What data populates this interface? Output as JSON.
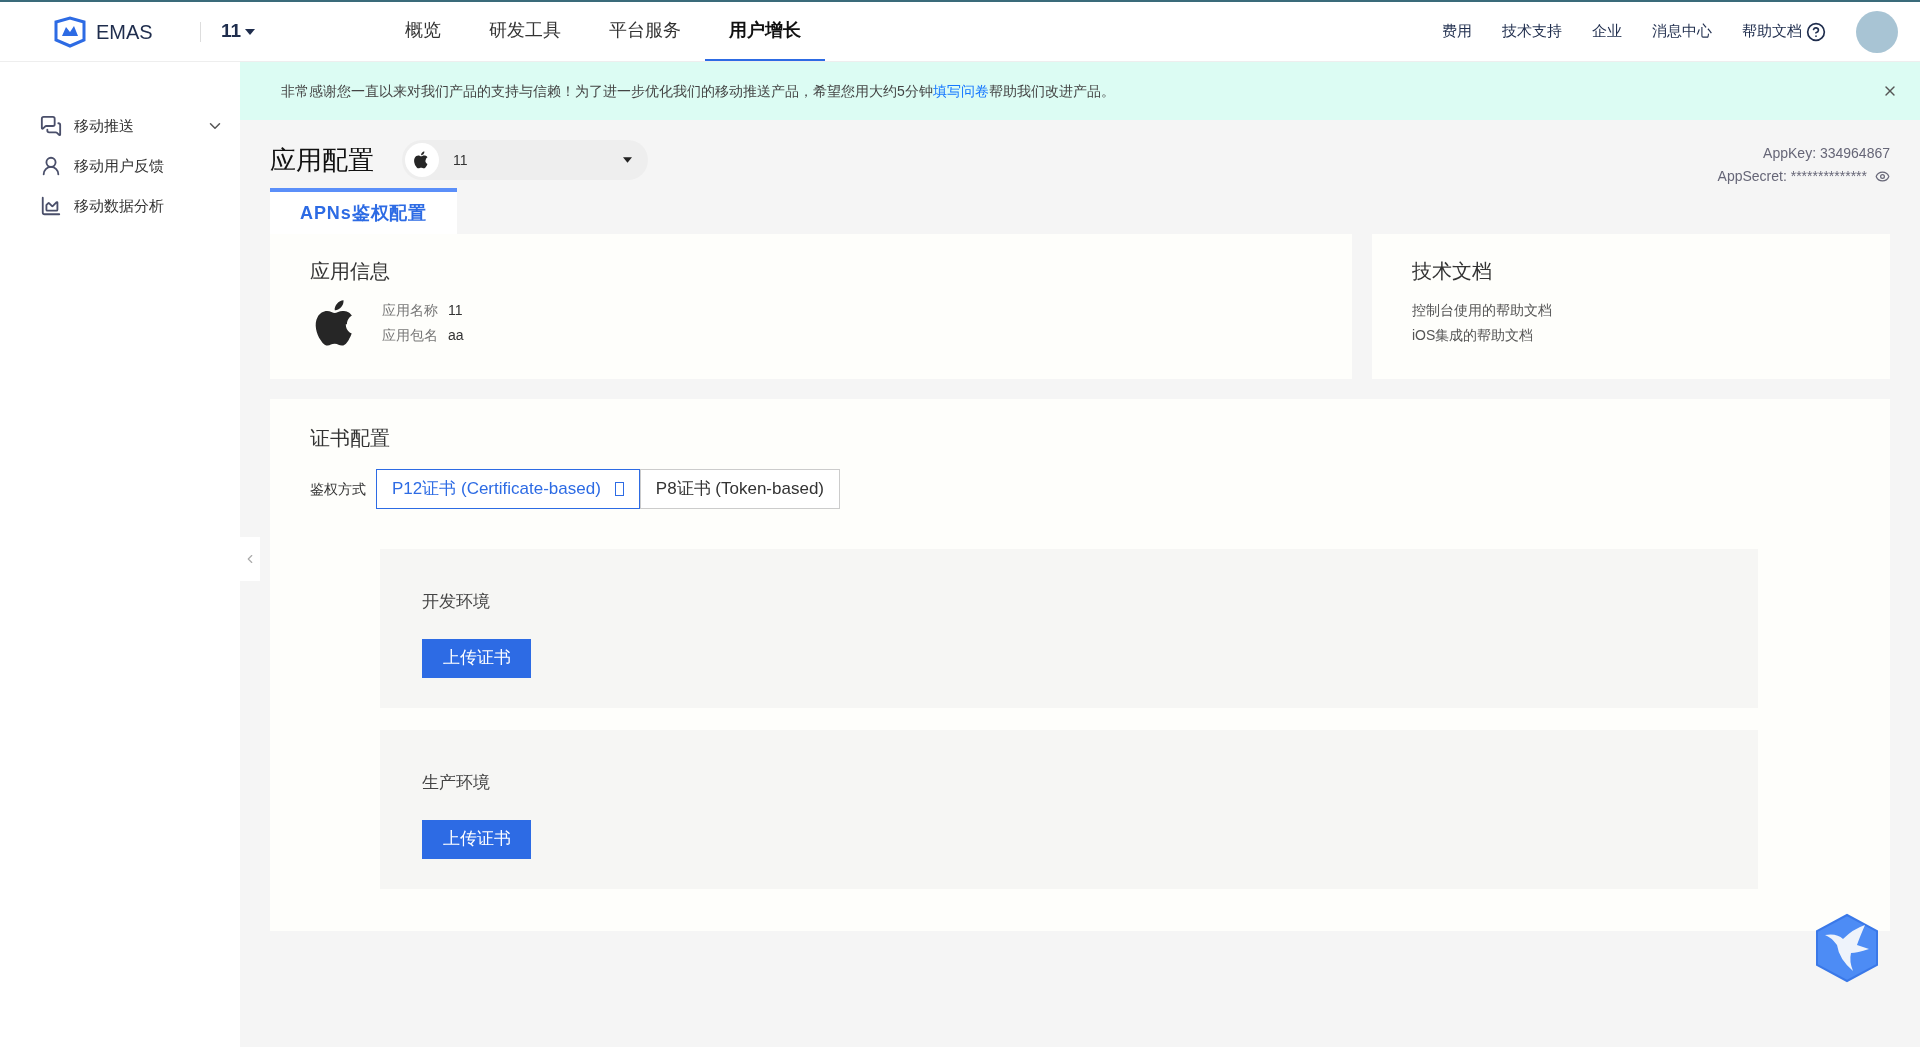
{
  "header": {
    "logo_text": "EMAS",
    "app_switcher": "11",
    "nav": [
      {
        "label": "概览",
        "selected": false
      },
      {
        "label": "研发工具",
        "selected": false
      },
      {
        "label": "平台服务",
        "selected": false
      },
      {
        "label": "用户增长",
        "selected": true
      }
    ],
    "links": [
      "费用",
      "技术支持",
      "企业",
      "消息中心",
      "帮助文档"
    ]
  },
  "sidebar": {
    "items": [
      {
        "label": "移动推送",
        "kind": "group",
        "expanded": false
      },
      {
        "label": "移动用户反馈",
        "kind": "item"
      },
      {
        "label": "移动数据分析",
        "kind": "item"
      }
    ]
  },
  "banner": {
    "text_before": "非常感谢您一直以来对我们产品的支持与信赖！为了进一步优化我们的移动推送产品，希望您用大约5分钟",
    "link": "填写问卷",
    "text_after": "帮助我们改进产品。"
  },
  "page": {
    "title": "应用配置",
    "app_select": "11",
    "appkey": "AppKey: 334964867",
    "appsecret": "AppSecret: **************"
  },
  "tabs": [
    {
      "label": "APNs鉴权配置",
      "selected": true
    }
  ],
  "app_info": {
    "title": "应用信息",
    "fields": [
      {
        "label": "应用名称",
        "value": "11"
      },
      {
        "label": "应用包名",
        "value": "aa"
      }
    ]
  },
  "tech_docs": {
    "title": "技术文档",
    "links": [
      "控制台使用的帮助文档",
      "iOS集成的帮助文档"
    ]
  },
  "cert": {
    "title": "证书配置",
    "auth_label": "鉴权方式",
    "options": [
      {
        "label": "P12证书 (Certificate-based)",
        "selected": true
      },
      {
        "label": "P8证书 (Token-based)",
        "selected": false
      }
    ],
    "environments": [
      {
        "title": "开发环境",
        "button": "上传证书"
      },
      {
        "title": "生产环境",
        "button": "上传证书"
      }
    ]
  }
}
